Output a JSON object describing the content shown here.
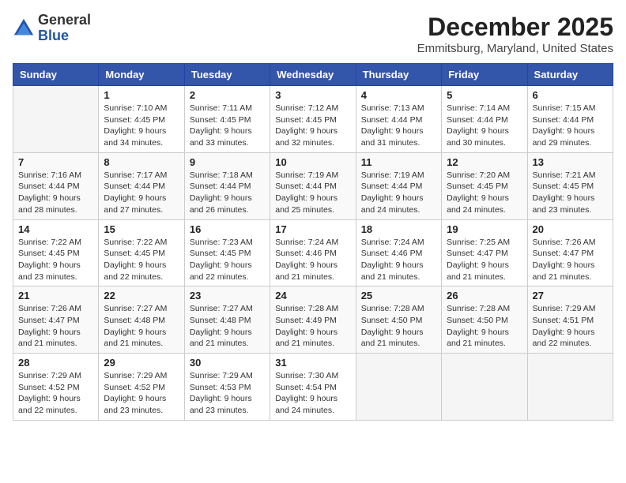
{
  "header": {
    "logo_general": "General",
    "logo_blue": "Blue",
    "month": "December 2025",
    "location": "Emmitsburg, Maryland, United States"
  },
  "days_of_week": [
    "Sunday",
    "Monday",
    "Tuesday",
    "Wednesday",
    "Thursday",
    "Friday",
    "Saturday"
  ],
  "weeks": [
    [
      {
        "day": "",
        "sunrise": "",
        "sunset": "",
        "daylight": ""
      },
      {
        "day": "1",
        "sunrise": "Sunrise: 7:10 AM",
        "sunset": "Sunset: 4:45 PM",
        "daylight": "Daylight: 9 hours and 34 minutes."
      },
      {
        "day": "2",
        "sunrise": "Sunrise: 7:11 AM",
        "sunset": "Sunset: 4:45 PM",
        "daylight": "Daylight: 9 hours and 33 minutes."
      },
      {
        "day": "3",
        "sunrise": "Sunrise: 7:12 AM",
        "sunset": "Sunset: 4:45 PM",
        "daylight": "Daylight: 9 hours and 32 minutes."
      },
      {
        "day": "4",
        "sunrise": "Sunrise: 7:13 AM",
        "sunset": "Sunset: 4:44 PM",
        "daylight": "Daylight: 9 hours and 31 minutes."
      },
      {
        "day": "5",
        "sunrise": "Sunrise: 7:14 AM",
        "sunset": "Sunset: 4:44 PM",
        "daylight": "Daylight: 9 hours and 30 minutes."
      },
      {
        "day": "6",
        "sunrise": "Sunrise: 7:15 AM",
        "sunset": "Sunset: 4:44 PM",
        "daylight": "Daylight: 9 hours and 29 minutes."
      }
    ],
    [
      {
        "day": "7",
        "sunrise": "Sunrise: 7:16 AM",
        "sunset": "Sunset: 4:44 PM",
        "daylight": "Daylight: 9 hours and 28 minutes."
      },
      {
        "day": "8",
        "sunrise": "Sunrise: 7:17 AM",
        "sunset": "Sunset: 4:44 PM",
        "daylight": "Daylight: 9 hours and 27 minutes."
      },
      {
        "day": "9",
        "sunrise": "Sunrise: 7:18 AM",
        "sunset": "Sunset: 4:44 PM",
        "daylight": "Daylight: 9 hours and 26 minutes."
      },
      {
        "day": "10",
        "sunrise": "Sunrise: 7:19 AM",
        "sunset": "Sunset: 4:44 PM",
        "daylight": "Daylight: 9 hours and 25 minutes."
      },
      {
        "day": "11",
        "sunrise": "Sunrise: 7:19 AM",
        "sunset": "Sunset: 4:44 PM",
        "daylight": "Daylight: 9 hours and 24 minutes."
      },
      {
        "day": "12",
        "sunrise": "Sunrise: 7:20 AM",
        "sunset": "Sunset: 4:45 PM",
        "daylight": "Daylight: 9 hours and 24 minutes."
      },
      {
        "day": "13",
        "sunrise": "Sunrise: 7:21 AM",
        "sunset": "Sunset: 4:45 PM",
        "daylight": "Daylight: 9 hours and 23 minutes."
      }
    ],
    [
      {
        "day": "14",
        "sunrise": "Sunrise: 7:22 AM",
        "sunset": "Sunset: 4:45 PM",
        "daylight": "Daylight: 9 hours and 23 minutes."
      },
      {
        "day": "15",
        "sunrise": "Sunrise: 7:22 AM",
        "sunset": "Sunset: 4:45 PM",
        "daylight": "Daylight: 9 hours and 22 minutes."
      },
      {
        "day": "16",
        "sunrise": "Sunrise: 7:23 AM",
        "sunset": "Sunset: 4:45 PM",
        "daylight": "Daylight: 9 hours and 22 minutes."
      },
      {
        "day": "17",
        "sunrise": "Sunrise: 7:24 AM",
        "sunset": "Sunset: 4:46 PM",
        "daylight": "Daylight: 9 hours and 21 minutes."
      },
      {
        "day": "18",
        "sunrise": "Sunrise: 7:24 AM",
        "sunset": "Sunset: 4:46 PM",
        "daylight": "Daylight: 9 hours and 21 minutes."
      },
      {
        "day": "19",
        "sunrise": "Sunrise: 7:25 AM",
        "sunset": "Sunset: 4:47 PM",
        "daylight": "Daylight: 9 hours and 21 minutes."
      },
      {
        "day": "20",
        "sunrise": "Sunrise: 7:26 AM",
        "sunset": "Sunset: 4:47 PM",
        "daylight": "Daylight: 9 hours and 21 minutes."
      }
    ],
    [
      {
        "day": "21",
        "sunrise": "Sunrise: 7:26 AM",
        "sunset": "Sunset: 4:47 PM",
        "daylight": "Daylight: 9 hours and 21 minutes."
      },
      {
        "day": "22",
        "sunrise": "Sunrise: 7:27 AM",
        "sunset": "Sunset: 4:48 PM",
        "daylight": "Daylight: 9 hours and 21 minutes."
      },
      {
        "day": "23",
        "sunrise": "Sunrise: 7:27 AM",
        "sunset": "Sunset: 4:48 PM",
        "daylight": "Daylight: 9 hours and 21 minutes."
      },
      {
        "day": "24",
        "sunrise": "Sunrise: 7:28 AM",
        "sunset": "Sunset: 4:49 PM",
        "daylight": "Daylight: 9 hours and 21 minutes."
      },
      {
        "day": "25",
        "sunrise": "Sunrise: 7:28 AM",
        "sunset": "Sunset: 4:50 PM",
        "daylight": "Daylight: 9 hours and 21 minutes."
      },
      {
        "day": "26",
        "sunrise": "Sunrise: 7:28 AM",
        "sunset": "Sunset: 4:50 PM",
        "daylight": "Daylight: 9 hours and 21 minutes."
      },
      {
        "day": "27",
        "sunrise": "Sunrise: 7:29 AM",
        "sunset": "Sunset: 4:51 PM",
        "daylight": "Daylight: 9 hours and 22 minutes."
      }
    ],
    [
      {
        "day": "28",
        "sunrise": "Sunrise: 7:29 AM",
        "sunset": "Sunset: 4:52 PM",
        "daylight": "Daylight: 9 hours and 22 minutes."
      },
      {
        "day": "29",
        "sunrise": "Sunrise: 7:29 AM",
        "sunset": "Sunset: 4:52 PM",
        "daylight": "Daylight: 9 hours and 23 minutes."
      },
      {
        "day": "30",
        "sunrise": "Sunrise: 7:29 AM",
        "sunset": "Sunset: 4:53 PM",
        "daylight": "Daylight: 9 hours and 23 minutes."
      },
      {
        "day": "31",
        "sunrise": "Sunrise: 7:30 AM",
        "sunset": "Sunset: 4:54 PM",
        "daylight": "Daylight: 9 hours and 24 minutes."
      },
      {
        "day": "",
        "sunrise": "",
        "sunset": "",
        "daylight": ""
      },
      {
        "day": "",
        "sunrise": "",
        "sunset": "",
        "daylight": ""
      },
      {
        "day": "",
        "sunrise": "",
        "sunset": "",
        "daylight": ""
      }
    ]
  ]
}
